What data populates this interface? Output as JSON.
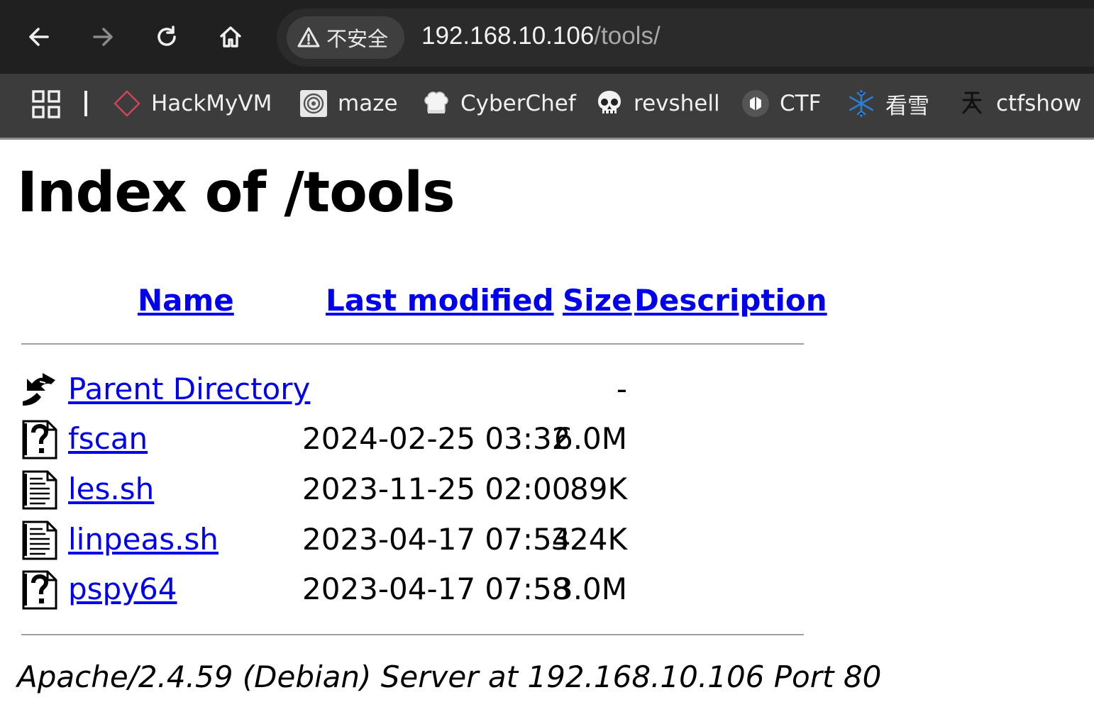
{
  "browser": {
    "security_chip": "不安全",
    "url_host": "192.168.10.106",
    "url_path": "/tools/",
    "bookmarks": [
      {
        "label": "HackMyVM",
        "icon": "diamond-icon"
      },
      {
        "label": "maze",
        "icon": "maze-icon"
      },
      {
        "label": "CyberChef",
        "icon": "chef-hat-icon"
      },
      {
        "label": "revshell",
        "icon": "skull-icon"
      },
      {
        "label": "CTF",
        "icon": "ctf-icon"
      },
      {
        "label": "看雪",
        "icon": "snowflake-icon"
      },
      {
        "label": "ctfshow",
        "icon": "ctfshow-icon"
      }
    ]
  },
  "page": {
    "title": "Index of /tools",
    "columns": {
      "name": "Name",
      "last_modified": "Last modified",
      "size": "Size",
      "description": "Description"
    },
    "entries": [
      {
        "name": "Parent Directory",
        "date": "",
        "size": "-",
        "icon": "back-arrow-icon"
      },
      {
        "name": "fscan",
        "date": "2024-02-25 03:32",
        "size": "6.0M",
        "icon": "unknown-file-icon"
      },
      {
        "name": "les.sh",
        "date": "2023-11-25 02:00",
        "size": "89K",
        "icon": "text-file-icon"
      },
      {
        "name": "linpeas.sh",
        "date": "2023-04-17 07:54",
        "size": "324K",
        "icon": "text-file-icon"
      },
      {
        "name": "pspy64",
        "date": "2023-04-17 07:58",
        "size": "3.0M",
        "icon": "unknown-file-icon"
      }
    ],
    "footer": "Apache/2.4.59 (Debian) Server at 192.168.10.106 Port 80"
  }
}
